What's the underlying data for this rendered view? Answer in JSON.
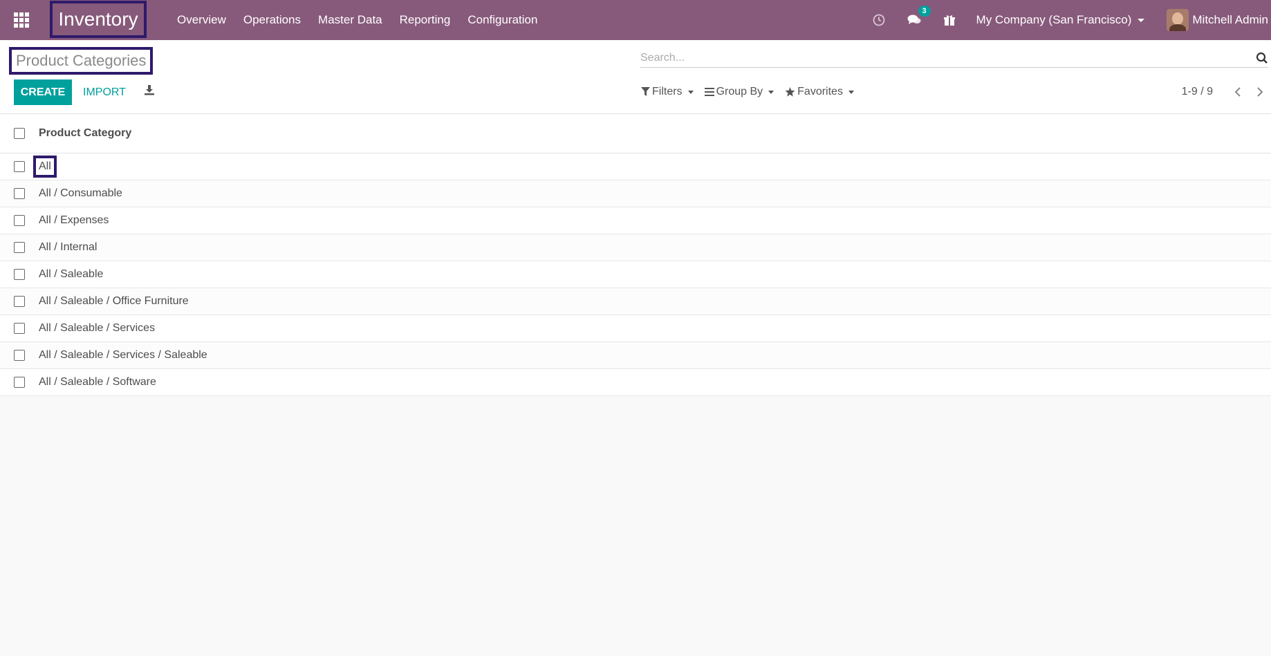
{
  "navbar": {
    "app_name": "Inventory",
    "menu": [
      "Overview",
      "Operations",
      "Master Data",
      "Reporting",
      "Configuration"
    ],
    "messages_count": "3",
    "company": "My Company (San Francisco)",
    "user": "Mitchell Admin",
    "color": "#875a7b"
  },
  "control": {
    "breadcrumb": "Product Categories",
    "search_placeholder": "Search...",
    "create_label": "CREATE",
    "import_label": "IMPORT",
    "filters_label": "Filters",
    "groupby_label": "Group By",
    "favorites_label": "Favorites",
    "pager": "1-9 / 9",
    "accent": "#00a09d"
  },
  "list": {
    "column": "Product Category",
    "rows": [
      "All",
      "All / Consumable",
      "All / Expenses",
      "All / Internal",
      "All / Saleable",
      "All / Saleable / Office Furniture",
      "All / Saleable / Services",
      "All / Saleable / Services / Saleable",
      "All / Saleable / Software"
    ]
  }
}
